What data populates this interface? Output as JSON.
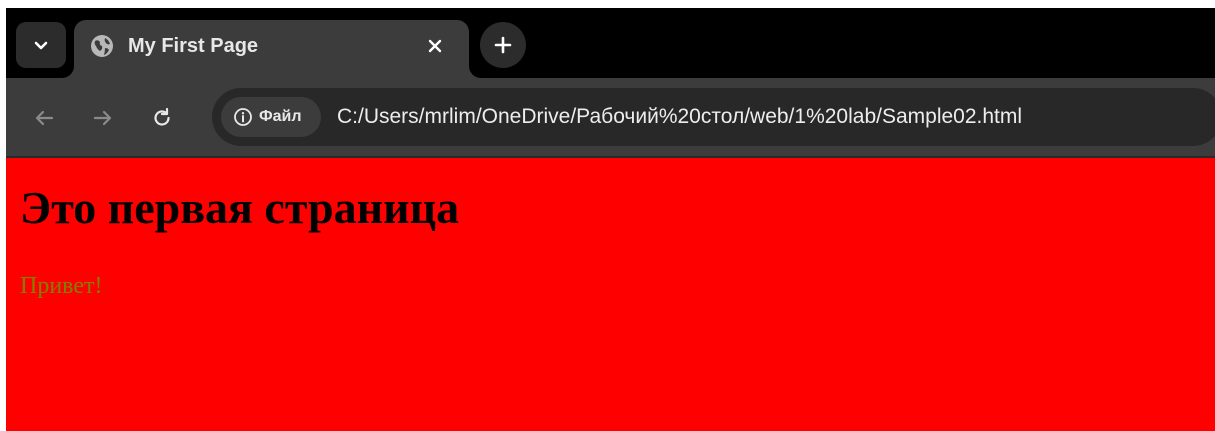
{
  "tab_strip": {
    "tab_search_icon": "chevron-down-icon",
    "active_tab": {
      "title": "My First Page",
      "favicon": "globe-icon",
      "close_icon": "close-icon"
    },
    "new_tab_icon": "plus-icon"
  },
  "toolbar": {
    "back_icon": "back-arrow-icon",
    "forward_icon": "forward-arrow-icon",
    "reload_icon": "reload-icon",
    "site_info": {
      "icon": "info-icon",
      "label": "Файл"
    },
    "url": "C:/Users/mrlim/OneDrive/Рабочий%20стол/web/1%20lab/Sample02.html"
  },
  "page": {
    "background": "#ff0000",
    "heading": "Это первая страница",
    "heading_color": "#000000",
    "paragraph": "Привет!",
    "paragraph_color": "#808000"
  },
  "colors": {
    "tab_strip": "#000000",
    "toolbar": "#3c3c3c",
    "omnibox": "#282828"
  }
}
